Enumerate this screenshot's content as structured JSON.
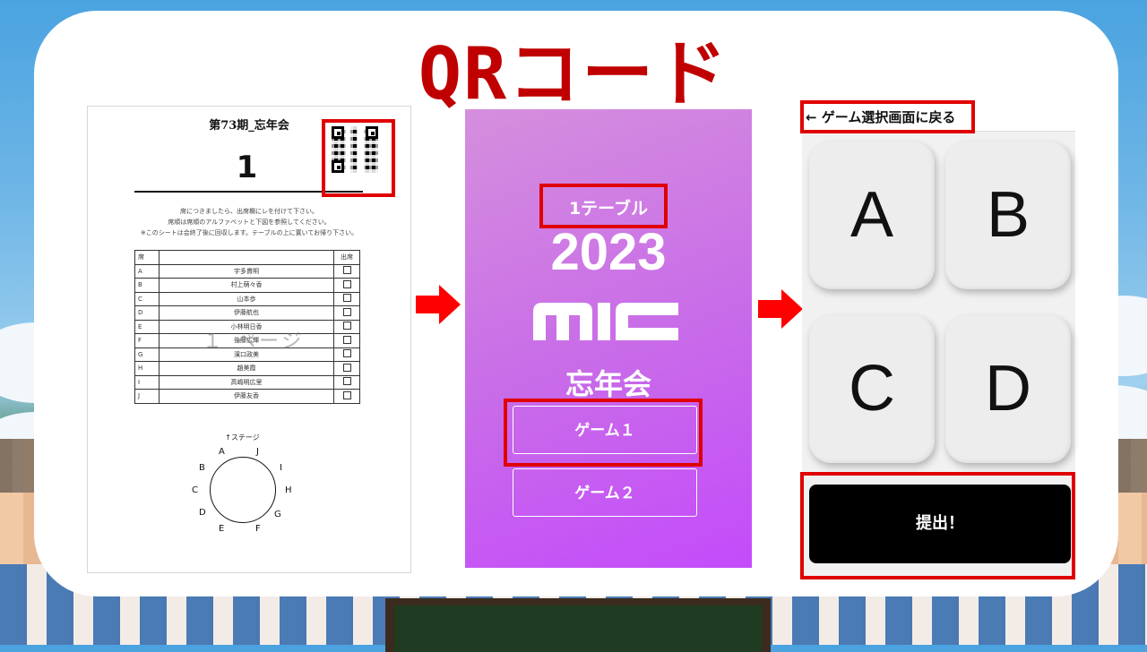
{
  "title": "QRコード",
  "colors": {
    "accent_red": "#c00000",
    "highlight_red": "#e00000",
    "phone_purple": "#c86ae9"
  },
  "sheet": {
    "title": "第73期_忘年会",
    "table_number": "1",
    "notes": [
      "席につきましたら、出席欄にレを付けて下さい。",
      "席順は席順のアルファベットと下図を参照してください。",
      "※このシートは会終了後に回収します。テーブルの上に置いてお帰り下さい。"
    ],
    "header": {
      "seat": "席",
      "attend": "出席"
    },
    "rows": [
      {
        "seat": "A",
        "name": "宇多貫明"
      },
      {
        "seat": "B",
        "name": "村上萌々香"
      },
      {
        "seat": "C",
        "name": "山本歩"
      },
      {
        "seat": "D",
        "name": "伊藤航也"
      },
      {
        "seat": "E",
        "name": "小林明日香"
      },
      {
        "seat": "F",
        "name": "後藤広輝"
      },
      {
        "seat": "G",
        "name": "濱口政美"
      },
      {
        "seat": "H",
        "name": "趙美霞"
      },
      {
        "seat": "I",
        "name": "高嶋明広里"
      },
      {
        "seat": "J",
        "name": "伊藤友香"
      }
    ],
    "watermark": "１ ページ",
    "stage_label": "↑ステージ",
    "seat_letters": [
      "A",
      "J",
      "I",
      "H",
      "G",
      "F",
      "E",
      "D",
      "C",
      "B"
    ]
  },
  "phone": {
    "table_label": "1テーブル",
    "year": "2023",
    "logo": "MIC",
    "event": "忘年会",
    "buttons": [
      "ゲーム１",
      "ゲーム２"
    ]
  },
  "answer": {
    "back_label": "← ゲーム選択画面に戻る",
    "keys": [
      "A",
      "B",
      "C",
      "D"
    ],
    "submit": "提出！"
  }
}
